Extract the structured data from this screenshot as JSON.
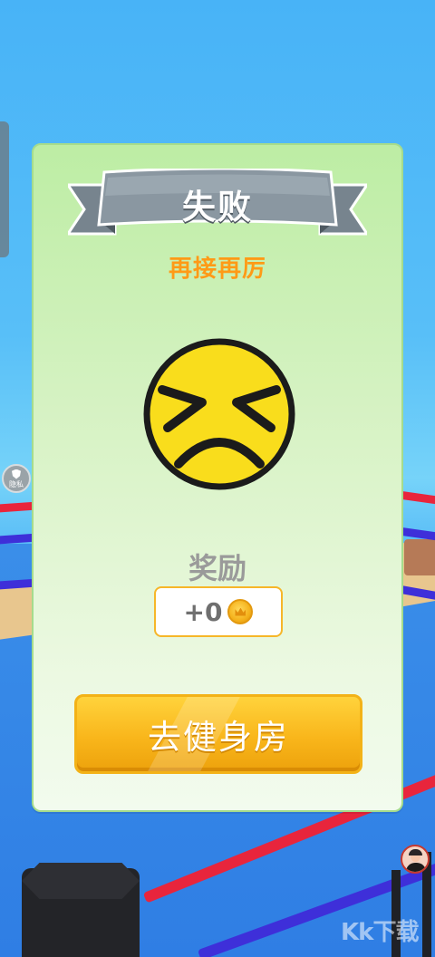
{
  "dialog": {
    "title": "失败",
    "subtitle": "再接再厉",
    "face_icon": "dizzy-sad-face-icon",
    "reward_label": "奖励",
    "reward_value": "+0",
    "reward_currency_icon": "gold-coin-icon",
    "gym_button_label": "去健身房"
  },
  "overlay": {
    "privacy_label": "隐私",
    "watermark": "Kk下载"
  },
  "colors": {
    "title_ribbon": "#7f8c96",
    "subtitle": "#ff9a16",
    "button": "#f9b61b",
    "dialog_background": "#d9f3c7",
    "sky": "#49b6f6"
  }
}
